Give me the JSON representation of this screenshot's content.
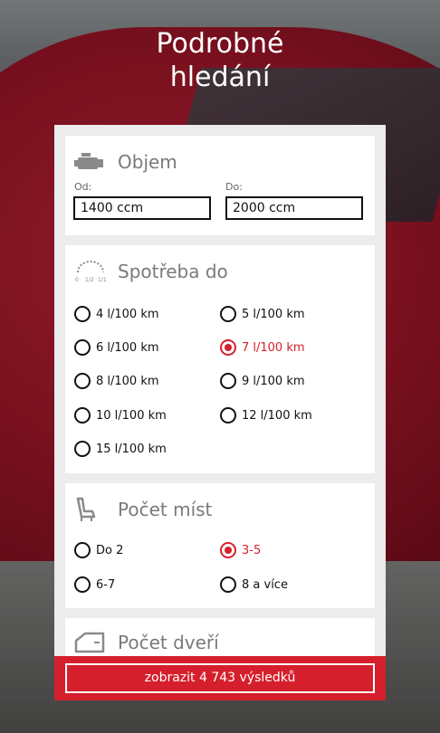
{
  "header": {
    "title_line1": "Podrobné",
    "title_line2": "hledání"
  },
  "volume": {
    "title": "Objem",
    "icon": "engine-icon",
    "from_label": "Od:",
    "from_value": "1400 ccm",
    "to_label": "Do:",
    "to_value": "2000 ccm"
  },
  "consumption": {
    "title": "Spotřeba do",
    "icon": "gauge-icon",
    "gauge_marks": [
      "0",
      "1/2",
      "1/1"
    ],
    "options": [
      {
        "label": "4 l/100 km",
        "selected": false
      },
      {
        "label": "5 l/100 km",
        "selected": false
      },
      {
        "label": "6 l/100 km",
        "selected": false
      },
      {
        "label": "7 l/100 km",
        "selected": true
      },
      {
        "label": "8 l/100 km",
        "selected": false
      },
      {
        "label": "9 l/100 km",
        "selected": false
      },
      {
        "label": "10 l/100 km",
        "selected": false
      },
      {
        "label": "12 l/100 km",
        "selected": false
      },
      {
        "label": "15 l/100 km",
        "selected": false
      }
    ]
  },
  "seats": {
    "title": "Počet míst",
    "icon": "seat-icon",
    "options": [
      {
        "label": "Do 2",
        "selected": false
      },
      {
        "label": "3-5",
        "selected": true
      },
      {
        "label": "6-7",
        "selected": false
      },
      {
        "label": "8 a více",
        "selected": false
      }
    ]
  },
  "doors": {
    "title": "Počet dveří",
    "icon": "door-icon"
  },
  "footer": {
    "button_label": "zobrazit 4 743 výsledků"
  },
  "colors": {
    "accent": "#d61f2c",
    "panel": "#ececec",
    "card": "#ffffff"
  }
}
